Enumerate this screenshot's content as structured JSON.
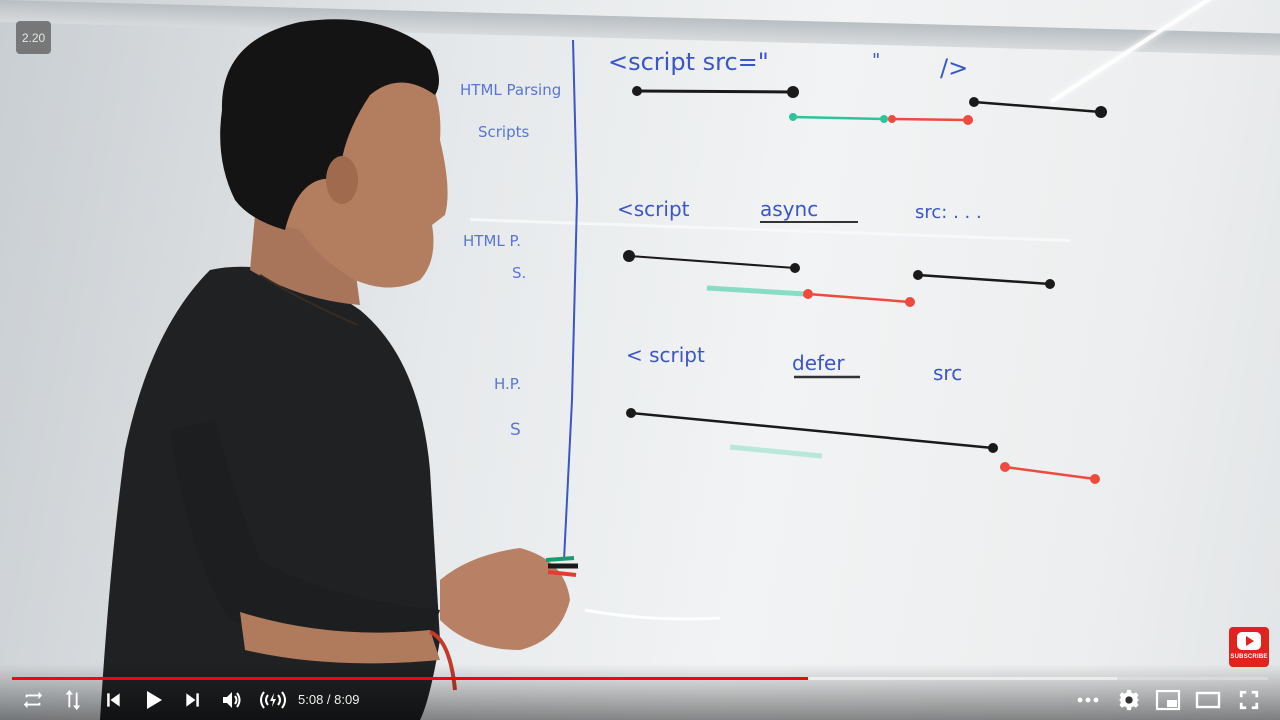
{
  "video": {
    "speed_badge": "2.20",
    "current_time": "5:08",
    "time_separator": " / ",
    "duration": "8:09",
    "played_fraction": 0.634,
    "buffered_fraction": 0.88,
    "subscribe_label": "SUBSCRIBE"
  },
  "whiteboard": {
    "left_labels": {
      "html_parsing": "HTML Parsing",
      "scripts": "Scripts",
      "html_p": "HTML P.",
      "s1": "S.",
      "hp": "H.P.",
      "s2": "S"
    },
    "lines": {
      "sync": {
        "text_open": "<script src=\"",
        "quote": "\"",
        "close": "/>"
      },
      "async": {
        "text": "<script",
        "keyword": "async",
        "tail": "src: . . ."
      },
      "defer": {
        "text": "< script",
        "keyword": "defer",
        "tail": "src"
      }
    },
    "colors": {
      "marker_blue": "#3a56c7",
      "black": "#1a1a1a",
      "green": "#2ec49a",
      "red": "#ee4a3e"
    }
  },
  "controls": {
    "repeat": "repeat-icon",
    "sort": "arrows-icon",
    "prev": "previous-icon",
    "play": "play-icon",
    "next": "next-icon",
    "volume": "volume-icon",
    "live": "live-icon",
    "more": "more-icon",
    "settings": "gear-icon",
    "miniplayer": "miniplayer-icon",
    "theater": "theater-icon",
    "fullscreen": "fullscreen-icon"
  }
}
